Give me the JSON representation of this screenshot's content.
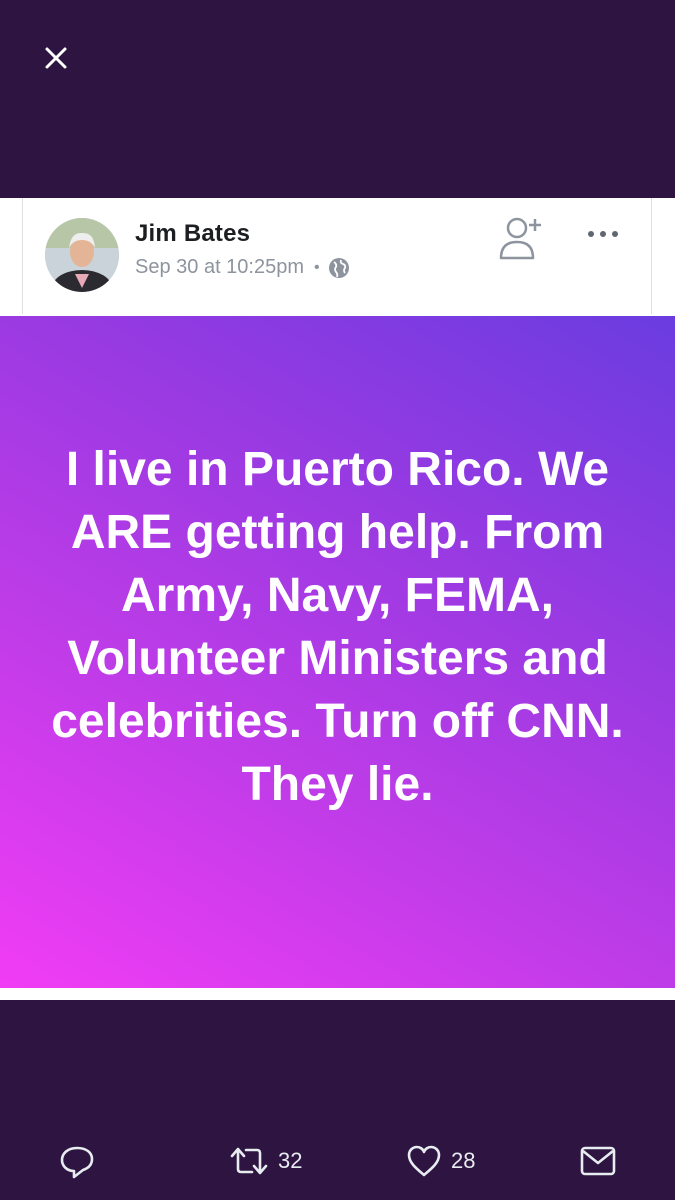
{
  "viewer": {
    "background": "#2e1440",
    "close_icon": "close-icon"
  },
  "post": {
    "author": "Jim Bates",
    "timestamp": "Sep 30 at 10:25pm",
    "separator": "•",
    "privacy_icon": "globe-icon",
    "add_friend_icon": "add-friend-icon",
    "more_icon": "more-dots-icon",
    "text": "I live in Puerto Rico. We ARE getting help. From Army, Navy, FEMA, Volunteer Ministers and celebrities. Turn off CNN. They lie.",
    "gradient_colors": [
      "#f13cf5",
      "#c03ce8",
      "#9a3ae2",
      "#6a3ce0"
    ]
  },
  "actions": {
    "reply_icon": "reply-icon",
    "retweet_icon": "retweet-icon",
    "retweet_count": "32",
    "like_icon": "heart-icon",
    "like_count": "28",
    "dm_icon": "mail-icon"
  }
}
